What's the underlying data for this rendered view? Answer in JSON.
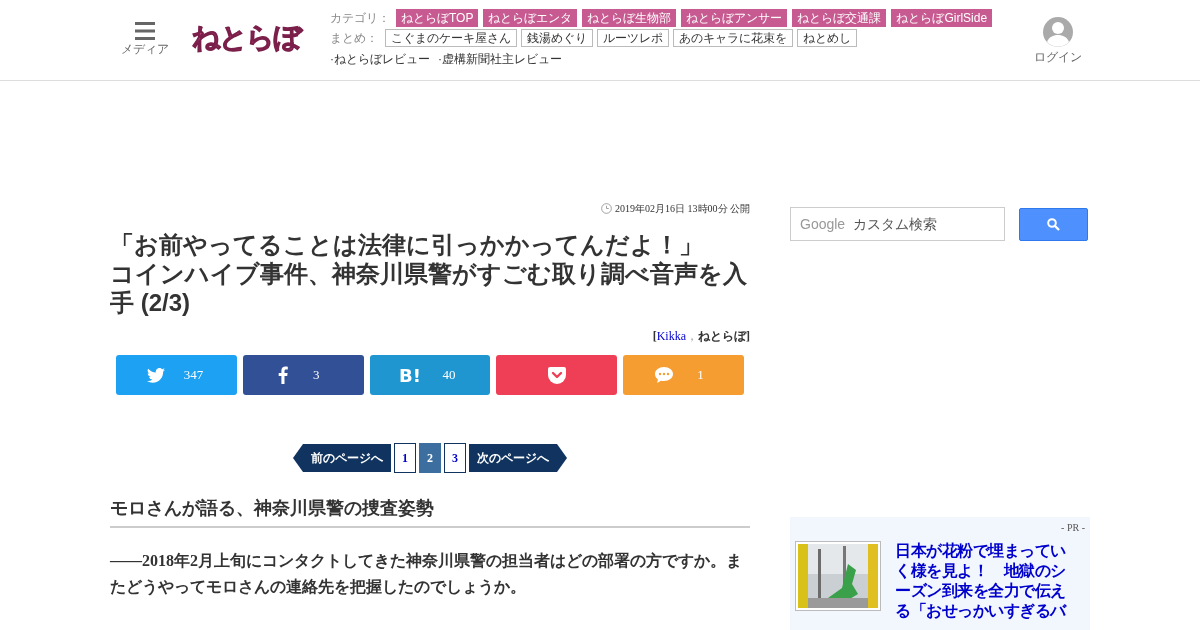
{
  "header": {
    "menu_label": "メディア",
    "logo": "ねとらぼ",
    "category_label": "カテゴリ：",
    "categories": [
      "ねとらぼTOP",
      "ねとらぼエンタ",
      "ねとらぼ生物部",
      "ねとらぼアンサー",
      "ねとらぼ交通課",
      "ねとらぼGirlSide"
    ],
    "matome_label": "まとめ：",
    "matome": [
      "こぐまのケーキ屋さん",
      "銭湯めぐり",
      "ルーツレポ",
      "あのキャラに花束を",
      "ねとめし"
    ],
    "reviews": [
      "·ねとらぼレビュー",
      "·虚構新聞社主レビュー"
    ],
    "login": "ログイン"
  },
  "article": {
    "date": "2019年02月16日 13時00分 公開",
    "title_lines": [
      "「お前やってることは法律に引っかかってんだよ！」",
      "コインハイブ事件、神奈川県警がすごむ取り調べ音声を入",
      "手 (2/3)"
    ],
    "byline": {
      "open": "[",
      "author": "Kikka",
      "sep": "，",
      "site": "ねとらぼ",
      "close": "]"
    },
    "share": [
      {
        "kind": "twitter",
        "count": "347"
      },
      {
        "kind": "facebook",
        "count": "3"
      },
      {
        "kind": "hatena",
        "label": "B!",
        "count": "40"
      },
      {
        "kind": "pocket"
      },
      {
        "kind": "comment",
        "count": "1"
      }
    ],
    "pager": {
      "prev": "前のページへ",
      "next": "次のページへ",
      "pages": [
        {
          "label": "1",
          "selected": false
        },
        {
          "label": "2",
          "selected": true
        },
        {
          "label": "3",
          "selected": false
        }
      ]
    },
    "heading": "モロさんが語る、神奈川県警の捜査姿勢",
    "question": "——2018年2月上旬にコンタクトしてきた神奈川県警の担当者はどの部署の方ですか。またどうやってモロさんの連絡先を把握したのでしょうか。"
  },
  "sidebar": {
    "search": {
      "brand": "Google",
      "placeholder": "カスタム検索"
    },
    "pr": {
      "label": "- PR -",
      "headline": "日本が花粉で埋まっていく様を見よ！　地獄のシーズン到来を全力で伝える「おせっかいすぎるバ"
    }
  }
}
